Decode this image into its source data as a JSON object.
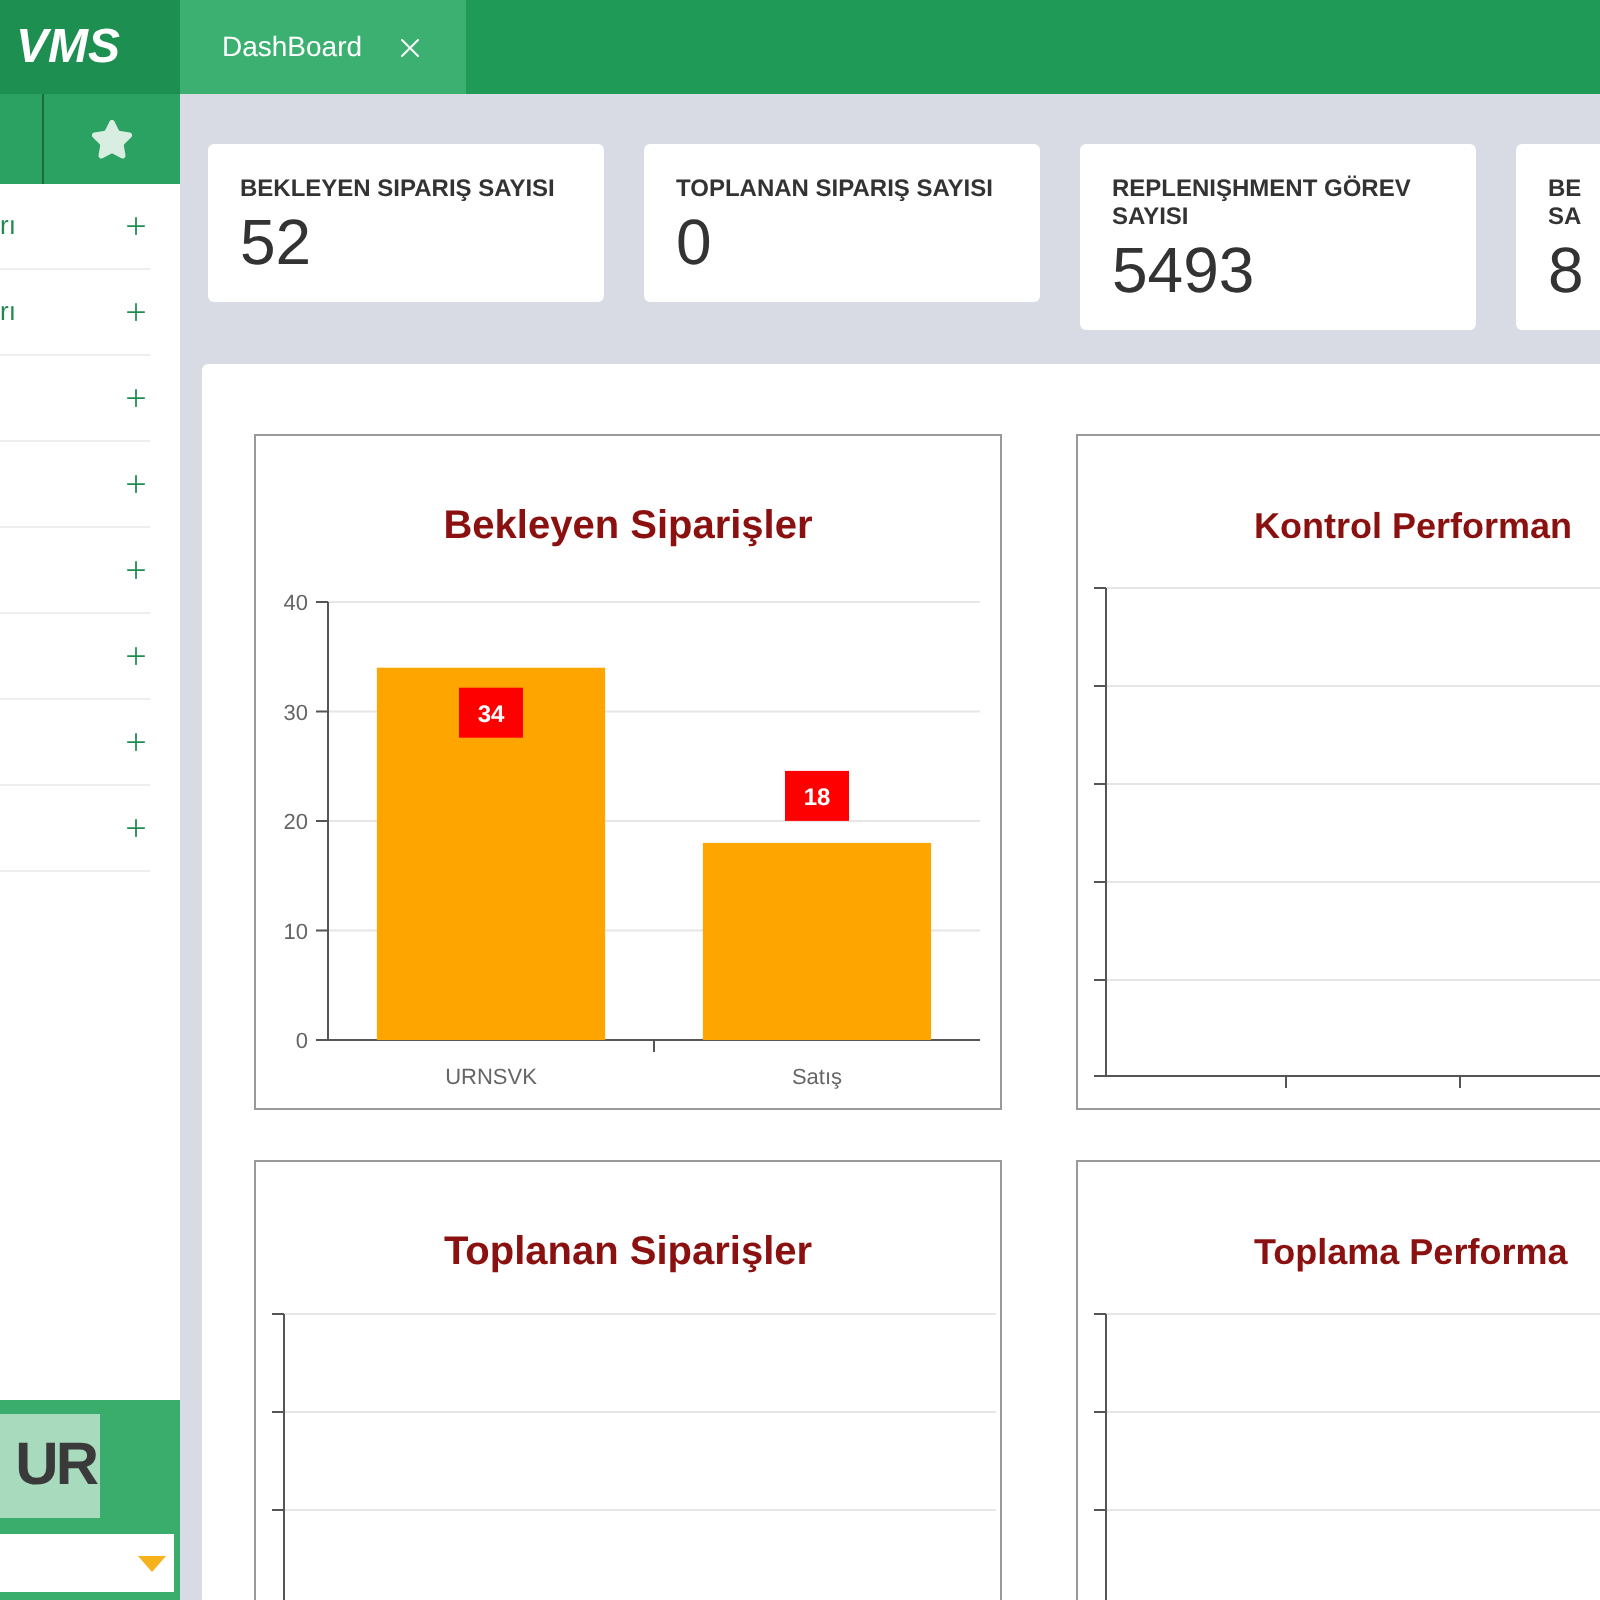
{
  "header": {
    "logo": "VMS",
    "tabs": [
      {
        "label": "DashBoard",
        "selected": true,
        "closable": true
      }
    ]
  },
  "sidebar": {
    "items": [
      {
        "label": "rı",
        "expanded": false
      },
      {
        "label": "rı",
        "expanded": false
      },
      {
        "expanded": false
      },
      {
        "expanded": false
      },
      {
        "expanded": false
      },
      {
        "expanded": false
      },
      {
        "expanded": false
      },
      {
        "expanded": false
      }
    ],
    "brand_logo": "UR"
  },
  "stat_cards": [
    {
      "title": "BEKLEYEN SIPARIŞ SAYISI",
      "value": "52"
    },
    {
      "title": "TOPLANAN SIPARIŞ SAYISI",
      "value": "0"
    },
    {
      "title": "REPLENIŞHMENT GÖREV SAYISI",
      "value": "5493"
    },
    {
      "title": "BE SA",
      "value": "8"
    }
  ],
  "charts": [
    {
      "title": "Bekleyen Siparişler",
      "chart_data": {
        "type": "bar",
        "categories": [
          "URNSVK",
          "Satış"
        ],
        "series": [
          {
            "color": "#ffa500",
            "values": [
              34,
              18
            ]
          }
        ],
        "ylim": [
          0,
          40
        ],
        "yticks": [
          0,
          10,
          20,
          30,
          40
        ],
        "grid": true,
        "data_labels": true
      }
    },
    {
      "title": "Kontrol Performan"
    },
    {
      "title": "Toplanan Siparişler"
    },
    {
      "title": "Toplama Performa"
    }
  ]
}
